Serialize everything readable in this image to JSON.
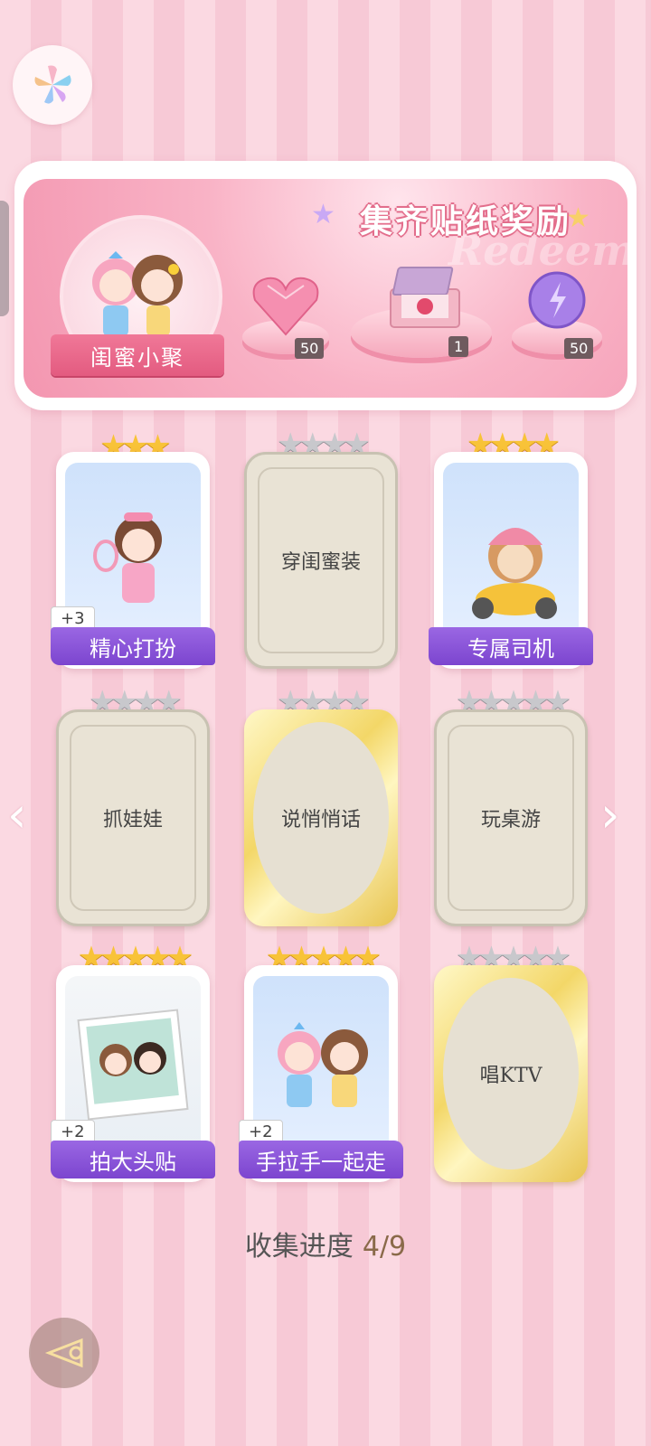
{
  "app": {
    "logo_icon": "pinwheel-icon"
  },
  "banner": {
    "title": "集齐贴纸奖励",
    "watermark": "Redeem",
    "avatar_label": "闺蜜小聚",
    "rewards": [
      {
        "icon": "pink-heart-gem-icon",
        "count": "50"
      },
      {
        "icon": "gift-box-icon",
        "count": "1"
      },
      {
        "icon": "purple-energy-orb-icon",
        "count": "50"
      }
    ]
  },
  "cards": [
    {
      "label": "精心打扮",
      "state": "collected",
      "stars": 3,
      "plus": "+3"
    },
    {
      "label": "穿闺蜜装",
      "state": "empty",
      "stars": 4
    },
    {
      "label": "专属司机",
      "state": "collected",
      "stars": 4
    },
    {
      "label": "抓娃娃",
      "state": "empty",
      "stars": 4
    },
    {
      "label": "说悄悄话",
      "state": "gold",
      "stars": 4
    },
    {
      "label": "玩桌游",
      "state": "empty",
      "stars": 5
    },
    {
      "label": "拍大头贴",
      "state": "collected",
      "stars": 5,
      "plus": "+2"
    },
    {
      "label": "手拉手一起走",
      "state": "collected",
      "stars": 5,
      "plus": "+2"
    },
    {
      "label": "唱KTV",
      "state": "gold",
      "stars": 5
    }
  ],
  "progress": {
    "label": "收集进度",
    "value": "4/9"
  },
  "nav": {
    "prev_icon": "chevron-left-icon",
    "next_icon": "chevron-right-icon",
    "back_icon": "back-arrow-icon"
  },
  "colors": {
    "accent_pink": "#f396b0",
    "label_purple": "#8a52d8",
    "star_gold": "#f8c338"
  }
}
